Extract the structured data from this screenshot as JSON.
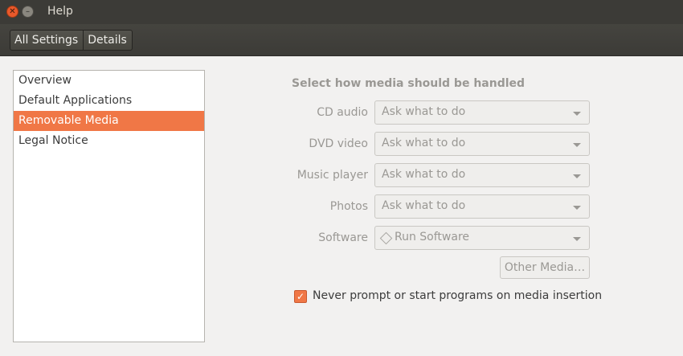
{
  "window": {
    "title": "Help"
  },
  "toolbar": {
    "tabs": [
      "All Settings",
      "Details"
    ]
  },
  "sidebar": {
    "items": [
      "Overview",
      "Default Applications",
      "Removable Media",
      "Legal Notice"
    ],
    "selected": "Removable Media"
  },
  "main": {
    "heading": "Select how media should be handled",
    "rows": [
      {
        "label": "CD audio",
        "value": "Ask what to do"
      },
      {
        "label": "DVD video",
        "value": "Ask what to do"
      },
      {
        "label": "Music player",
        "value": "Ask what to do"
      },
      {
        "label": "Photos",
        "value": "Ask what to do"
      },
      {
        "label": "Software",
        "value": "Run Software"
      }
    ],
    "other_media_label": "Other Media…",
    "never_prompt": {
      "label": "Never prompt or start programs on media insertion",
      "checked": true
    }
  },
  "colors": {
    "accent": "#f07746",
    "titlebar": "#3c3b37"
  },
  "icons": {
    "close": "close-icon",
    "minimize": "minimize-icon",
    "software": "software-diamond-icon",
    "dropdown": "chevron-down-icon",
    "check": "checkmark-icon"
  }
}
